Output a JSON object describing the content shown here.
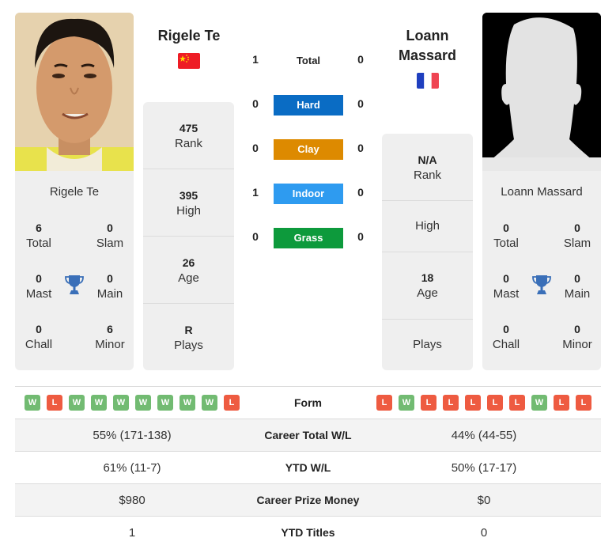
{
  "player1": {
    "name": "Rigele Te",
    "country": "China",
    "flag_icon": "china-flag-icon",
    "photo": "player-photo",
    "card": {
      "name": "Rigele Te",
      "stats": [
        {
          "value": "6",
          "label": "Total"
        },
        {
          "value": "0",
          "label": "Slam"
        },
        {
          "value": "0",
          "label": "Mast"
        },
        {
          "value": "0",
          "label": "Main"
        },
        {
          "value": "0",
          "label": "Chall"
        },
        {
          "value": "6",
          "label": "Minor"
        }
      ]
    },
    "info": [
      {
        "value": "475",
        "label": "Rank"
      },
      {
        "value": "395",
        "label": "High"
      },
      {
        "value": "26",
        "label": "Age"
      },
      {
        "value": "R",
        "label": "Plays"
      }
    ],
    "form": [
      "W",
      "L",
      "W",
      "W",
      "W",
      "W",
      "W",
      "W",
      "W",
      "L"
    ]
  },
  "player2": {
    "name": "Loann Massard",
    "name_line1": "Loann",
    "name_line2": "Massard",
    "country": "France",
    "flag_icon": "france-flag-icon",
    "photo": "silhouette-placeholder",
    "card": {
      "name": "Loann Massard",
      "stats": [
        {
          "value": "0",
          "label": "Total"
        },
        {
          "value": "0",
          "label": "Slam"
        },
        {
          "value": "0",
          "label": "Mast"
        },
        {
          "value": "0",
          "label": "Main"
        },
        {
          "value": "0",
          "label": "Chall"
        },
        {
          "value": "0",
          "label": "Minor"
        }
      ]
    },
    "info": [
      {
        "value": "N/A",
        "label": "Rank"
      },
      {
        "value": "",
        "label": "High"
      },
      {
        "value": "18",
        "label": "Age"
      },
      {
        "value": "",
        "label": "Plays"
      }
    ],
    "form": [
      "L",
      "W",
      "L",
      "L",
      "L",
      "L",
      "L",
      "W",
      "L",
      "L"
    ]
  },
  "h2h": {
    "total": {
      "label": "Total",
      "p1": "1",
      "p2": "0"
    },
    "surfaces": [
      {
        "label": "Hard",
        "p1": "0",
        "p2": "0",
        "color": "#0a6cc4"
      },
      {
        "label": "Clay",
        "p1": "0",
        "p2": "0",
        "color": "#dd8a00"
      },
      {
        "label": "Indoor",
        "p1": "1",
        "p2": "0",
        "color": "#2e9bf0"
      },
      {
        "label": "Grass",
        "p1": "0",
        "p2": "0",
        "color": "#0d9a3c"
      }
    ]
  },
  "stats_table": {
    "form_label": "Form",
    "rows": [
      {
        "label": "Career Total W/L",
        "p1": "55% (171-138)",
        "p2": "44% (44-55)"
      },
      {
        "label": "YTD W/L",
        "p1": "61% (11-7)",
        "p2": "50% (17-17)"
      },
      {
        "label": "Career Prize Money",
        "p1": "$980",
        "p2": "$0"
      },
      {
        "label": "YTD Titles",
        "p1": "1",
        "p2": "0"
      }
    ]
  },
  "colors": {
    "win": "#72bb72",
    "loss": "#ee5b41",
    "card_bg": "#efefef",
    "trophy": "#3a6fb8"
  }
}
